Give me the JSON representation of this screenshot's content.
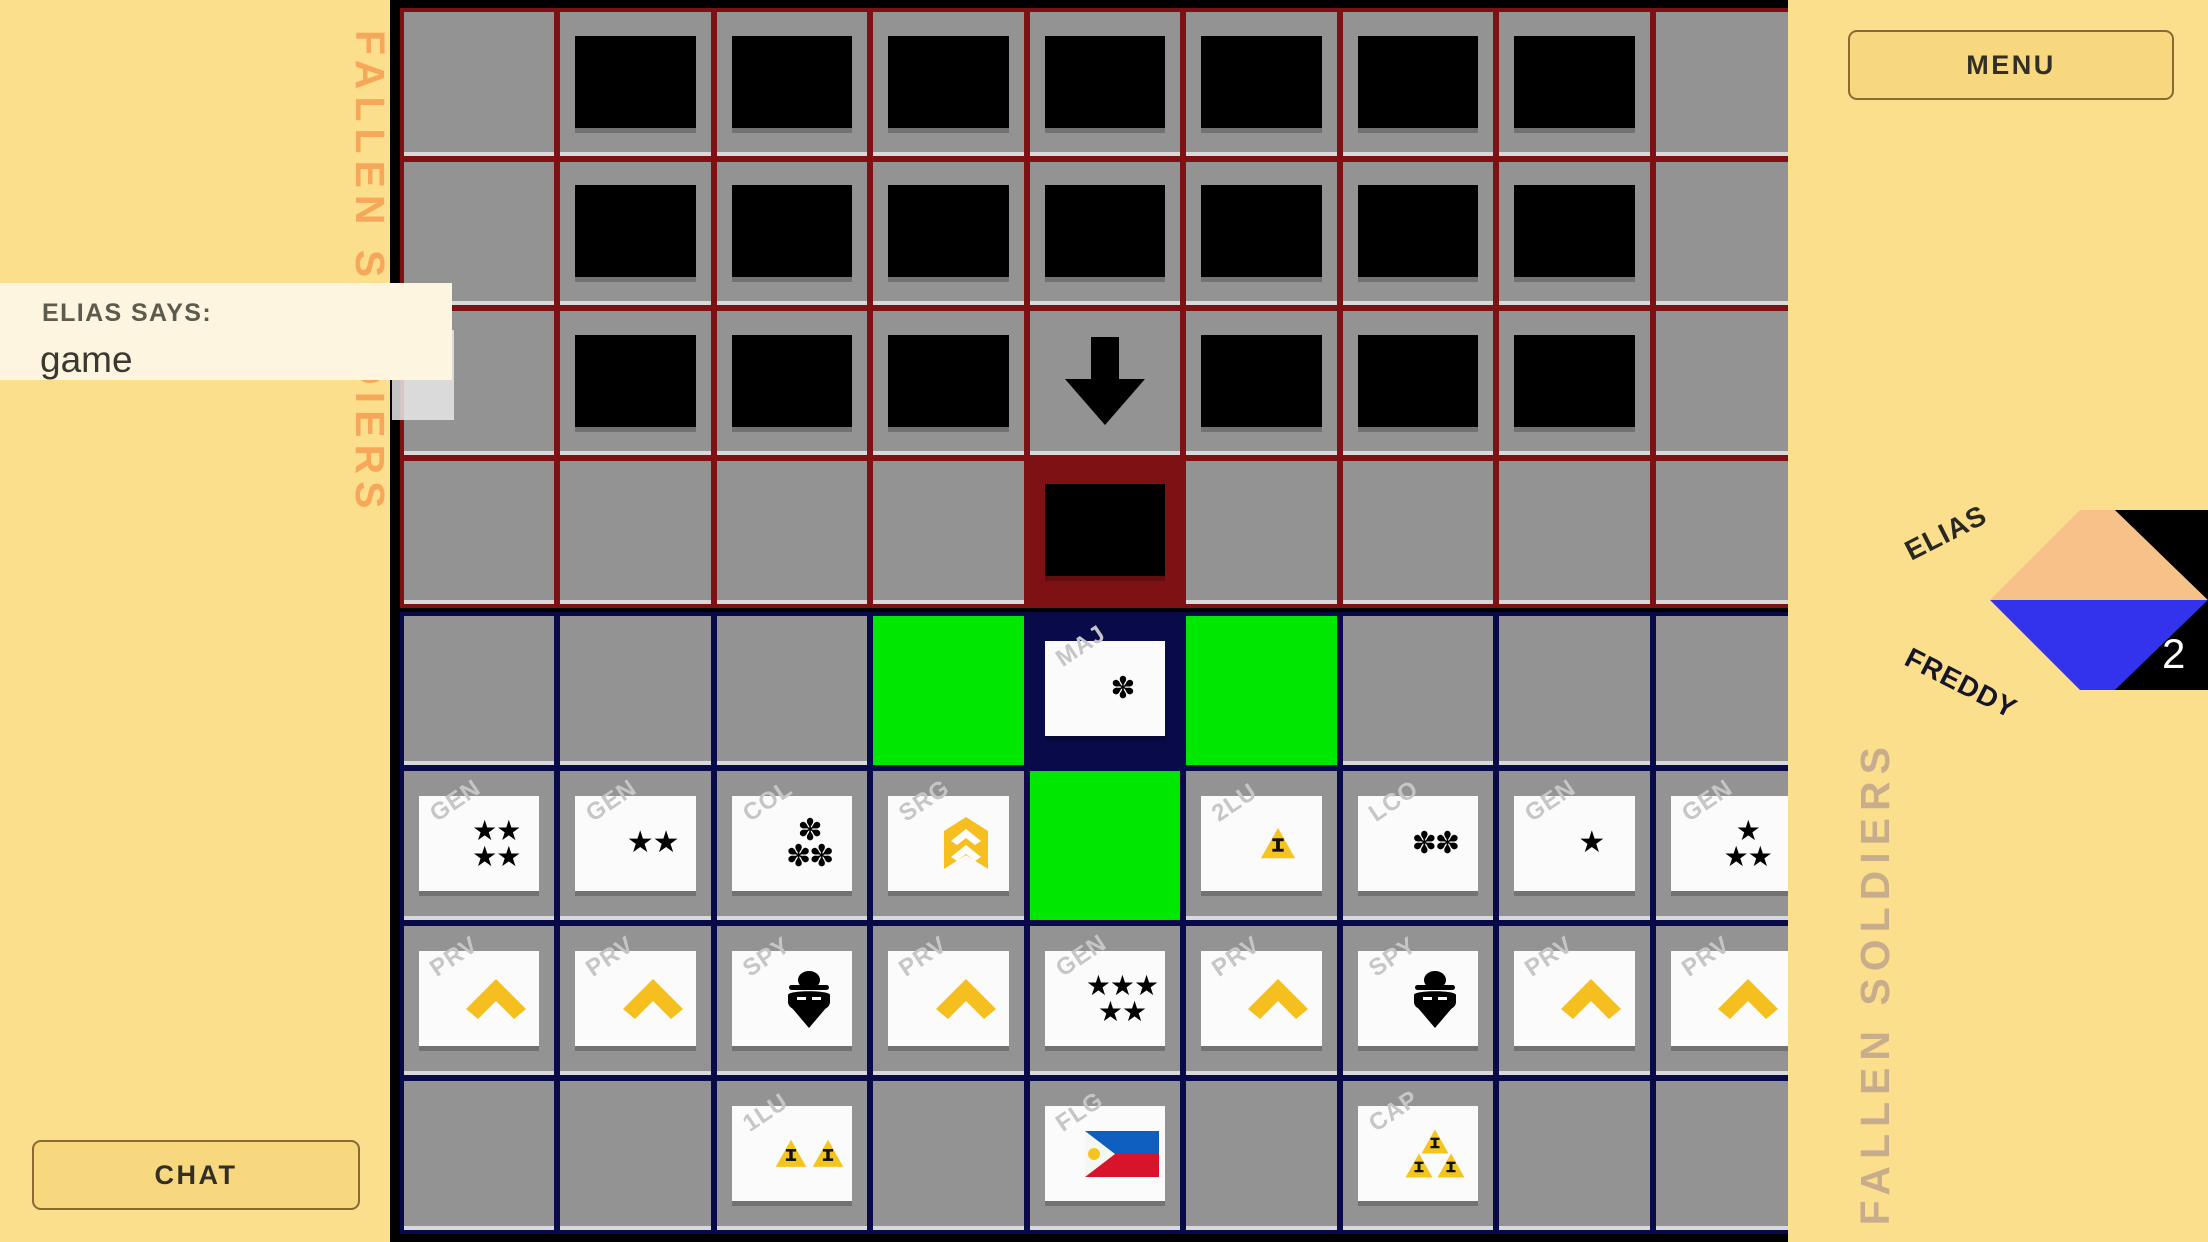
{
  "left_panel": {
    "fallen_soldiers_label": "FALLEN SOLDIERS",
    "chat": {
      "speaker": "ELIAS SAYS:",
      "message": "game"
    },
    "chat_button_label": "CHAT"
  },
  "right_panel": {
    "menu_button_label": "MENU",
    "fallen_soldiers_label": "FALLEN SOLDIERS",
    "turn_indicator": {
      "top_player": "ELIAS",
      "bottom_player": "FREDDY",
      "count": "2",
      "top_color": "#f7c289",
      "bottom_color": "#3333ee",
      "count_bg": "#000000"
    }
  },
  "board": {
    "top_grid_color": "#7e1113",
    "bottom_grid_color": "#090a4a",
    "cell_color": "#939393",
    "highlight_color": "#00e800",
    "rows": 8,
    "cols": 9,
    "top_rows": [
      [
        {
          "type": "empty"
        },
        {
          "type": "facedown"
        },
        {
          "type": "facedown"
        },
        {
          "type": "facedown"
        },
        {
          "type": "facedown"
        },
        {
          "type": "facedown"
        },
        {
          "type": "facedown"
        },
        {
          "type": "facedown"
        },
        {
          "type": "empty"
        }
      ],
      [
        {
          "type": "empty"
        },
        {
          "type": "facedown"
        },
        {
          "type": "facedown"
        },
        {
          "type": "facedown"
        },
        {
          "type": "facedown"
        },
        {
          "type": "facedown"
        },
        {
          "type": "facedown"
        },
        {
          "type": "facedown"
        },
        {
          "type": "empty"
        }
      ],
      [
        {
          "type": "empty"
        },
        {
          "type": "facedown"
        },
        {
          "type": "facedown"
        },
        {
          "type": "facedown"
        },
        {
          "type": "arrow-down"
        },
        {
          "type": "facedown"
        },
        {
          "type": "facedown"
        },
        {
          "type": "facedown"
        },
        {
          "type": "empty"
        }
      ],
      [
        {
          "type": "empty"
        },
        {
          "type": "empty"
        },
        {
          "type": "empty"
        },
        {
          "type": "empty"
        },
        {
          "type": "facedown-selected"
        },
        {
          "type": "empty"
        },
        {
          "type": "empty"
        },
        {
          "type": "empty"
        },
        {
          "type": "empty"
        }
      ]
    ],
    "bottom_rows": [
      [
        {
          "type": "empty"
        },
        {
          "type": "empty"
        },
        {
          "type": "empty"
        },
        {
          "type": "green"
        },
        {
          "type": "piece",
          "rank": "MAJ",
          "insignia": "flower",
          "count": 1,
          "selected": true
        },
        {
          "type": "green"
        },
        {
          "type": "empty"
        },
        {
          "type": "empty"
        },
        {
          "type": "empty"
        }
      ],
      [
        {
          "type": "piece",
          "rank": "GEN",
          "insignia": "star",
          "count": 4
        },
        {
          "type": "piece",
          "rank": "GEN",
          "insignia": "star",
          "count": 2
        },
        {
          "type": "piece",
          "rank": "COL",
          "insignia": "flower",
          "count": 3
        },
        {
          "type": "piece",
          "rank": "SRG",
          "insignia": "chevron-badge",
          "count": 1
        },
        {
          "type": "green"
        },
        {
          "type": "piece",
          "rank": "2LU",
          "insignia": "triangle",
          "count": 1
        },
        {
          "type": "piece",
          "rank": "LCO",
          "insignia": "flower",
          "count": 2
        },
        {
          "type": "piece",
          "rank": "GEN",
          "insignia": "star",
          "count": 1
        },
        {
          "type": "piece",
          "rank": "GEN",
          "insignia": "star",
          "count": 3
        }
      ],
      [
        {
          "type": "piece",
          "rank": "PRV",
          "insignia": "chevron",
          "count": 1
        },
        {
          "type": "piece",
          "rank": "PRV",
          "insignia": "chevron",
          "count": 1
        },
        {
          "type": "piece",
          "rank": "SPY",
          "insignia": "spy",
          "count": 1
        },
        {
          "type": "piece",
          "rank": "PRV",
          "insignia": "chevron",
          "count": 1
        },
        {
          "type": "piece",
          "rank": "GEN",
          "insignia": "star",
          "count": 5
        },
        {
          "type": "piece",
          "rank": "PRV",
          "insignia": "chevron",
          "count": 1
        },
        {
          "type": "piece",
          "rank": "SPY",
          "insignia": "spy",
          "count": 1
        },
        {
          "type": "piece",
          "rank": "PRV",
          "insignia": "chevron",
          "count": 1
        },
        {
          "type": "piece",
          "rank": "PRV",
          "insignia": "chevron",
          "count": 1
        }
      ],
      [
        {
          "type": "empty"
        },
        {
          "type": "empty"
        },
        {
          "type": "piece",
          "rank": "1LU",
          "insignia": "triangle",
          "count": 2
        },
        {
          "type": "empty"
        },
        {
          "type": "piece",
          "rank": "FLG",
          "insignia": "flag-ph",
          "count": 1
        },
        {
          "type": "empty"
        },
        {
          "type": "piece",
          "rank": "CAP",
          "insignia": "triangle",
          "count": 3
        },
        {
          "type": "empty"
        },
        {
          "type": "empty"
        }
      ]
    ]
  }
}
